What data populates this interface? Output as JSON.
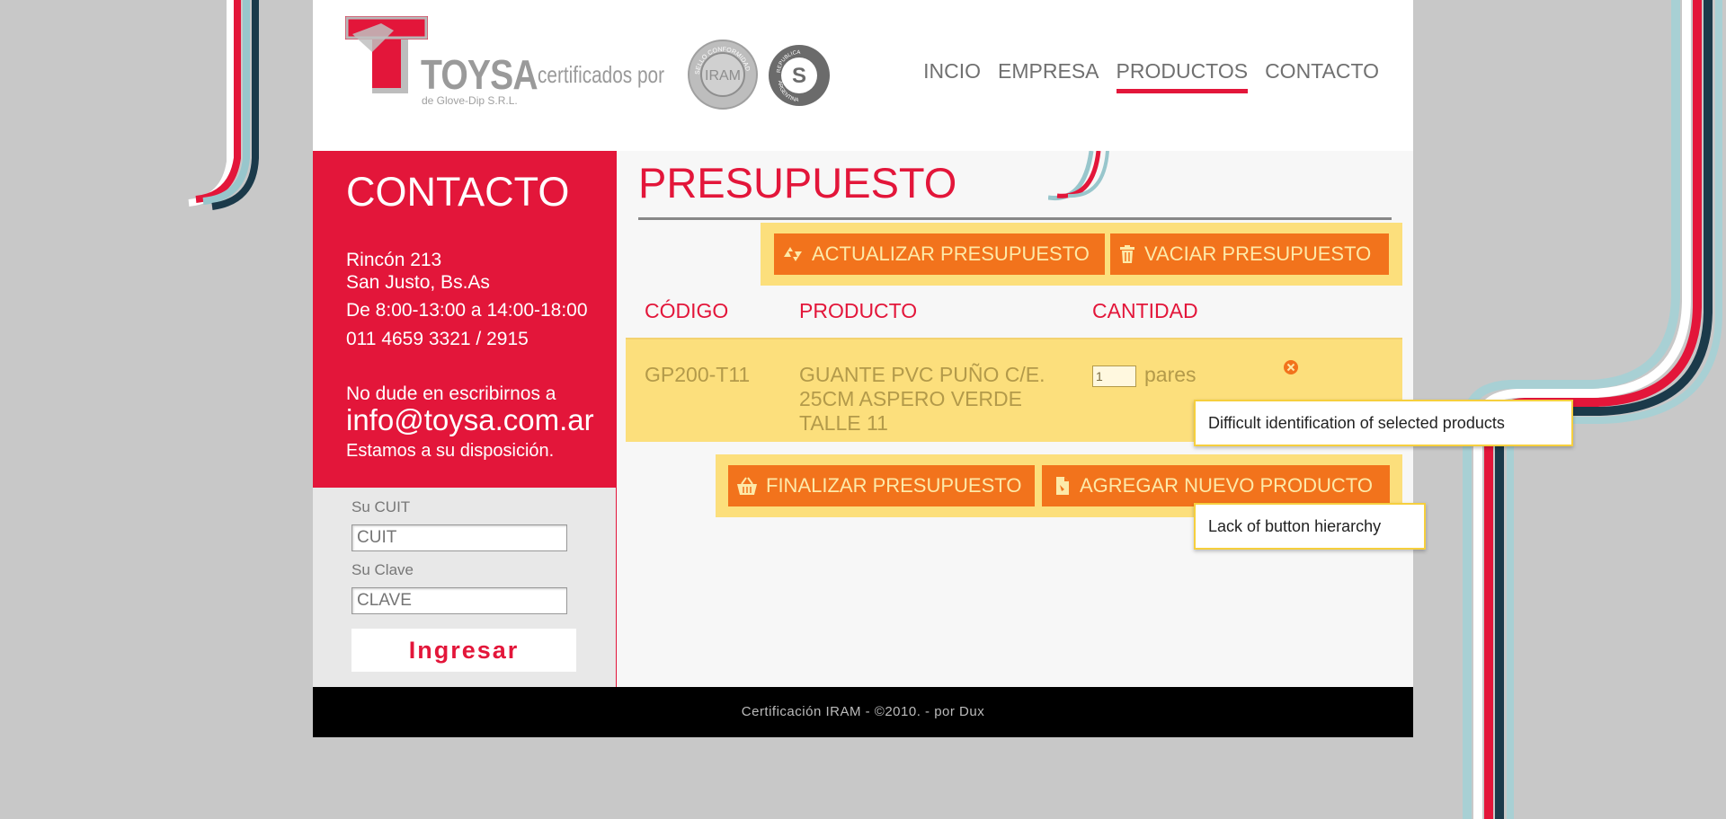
{
  "brand": {
    "name": "TOYSA",
    "subtitle": "de Glove-Dip S.R.L.",
    "cert_text": "certificados por",
    "seal_iram_top": "SELLO CONFORMIDAD NORMA",
    "seal_iram_center": "IRAM",
    "seal_s_top": "REPUBLICA",
    "seal_s_bottom": "ARGENTINA",
    "seal_s_center": "S",
    "colors": {
      "accent": "#e3163a",
      "button": "#f2731c",
      "highlight": "#fcdf7c"
    }
  },
  "nav": {
    "items": [
      {
        "label": "INCIO"
      },
      {
        "label": "EMPRESA"
      },
      {
        "label": "PRODUCTOS"
      },
      {
        "label": "CONTACTO"
      }
    ],
    "active": "PRODUCTOS"
  },
  "sidebar": {
    "contact_title": "CONTACTO",
    "address_line1": "Rincón 213",
    "address_line2": "San Justo, Bs.As",
    "hours": "De 8:00-13:00 a 14:00-18:00",
    "phone": "011 4659 3321 / 2915",
    "invite": "No dude en escribirnos a",
    "email": "info@toysa.com.ar",
    "closing": "Estamos a su disposición.",
    "login": {
      "cuit_label": "Su CUIT",
      "cuit_placeholder": "CUIT",
      "clave_label": "Su Clave",
      "clave_placeholder": "CLAVE",
      "submit_label": "Ingresar"
    }
  },
  "main": {
    "title": "PRESUPUESTO",
    "buttons_top": {
      "update_label": "ACTUALIZAR PRESUPUESTO",
      "empty_label": "VACIAR PRESUPUESTO"
    },
    "table": {
      "headers": [
        "CÓDIGO",
        "PRODUCTO",
        "CANTIDAD"
      ],
      "rows": [
        {
          "code": "GP200-T11",
          "product": "GUANTE PVC PUÑO C/E. 25CM ASPERO VERDE TALLE 11",
          "quantity": "1",
          "unit": "pares"
        }
      ]
    },
    "buttons_bottom": {
      "finish_label": "FINALIZAR PRESUPUESTO",
      "add_label": "AGREGAR NUEVO PRODUCTO"
    }
  },
  "footer": {
    "text": "Certificación IRAM - ©2010. - por Dux"
  },
  "annotations": [
    {
      "text": "Difficult identification of selected products"
    },
    {
      "text": "Lack of button hierarchy"
    }
  ]
}
